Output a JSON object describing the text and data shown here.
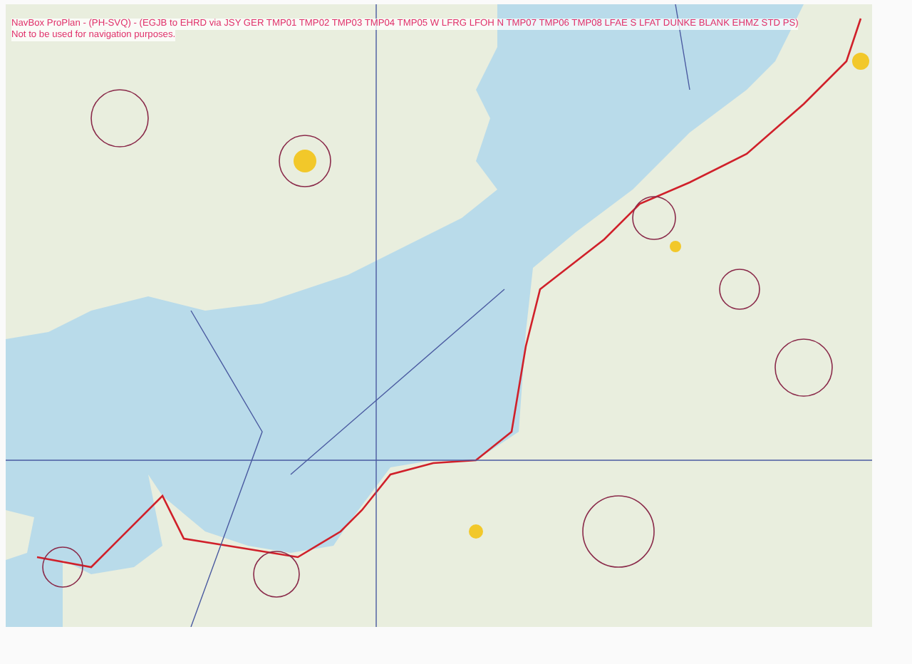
{
  "chart_header": {
    "title": "NavBox ProPlan - (PH-SVQ) - (EGJB to EHRD via JSY GER TMP01 TMP02 TMP03 TMP04 TMP05 W LFRG LFOH N TMP07 TMP06 TMP08 LFAE S LFAT DUNKE BLANK EHMZ STD PS)",
    "disclaimer": "Not to be used for navigation purposes."
  }
}
